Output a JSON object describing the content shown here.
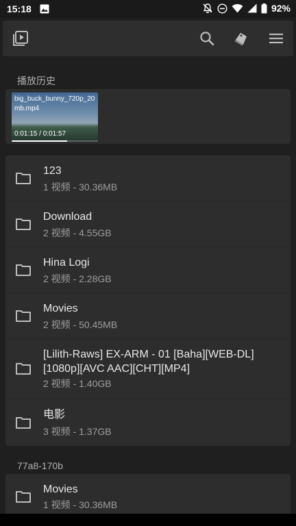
{
  "status_bar": {
    "time": "15:18",
    "battery_percent": "92%",
    "icons": [
      "image-icon",
      "bell-off-icon",
      "do-not-disturb-icon",
      "wifi-icon",
      "signal-icon",
      "battery-icon"
    ]
  },
  "toolbar": {
    "icons": [
      "video-library-icon",
      "search-icon",
      "tags-icon",
      "menu-icon"
    ]
  },
  "history": {
    "label": "播放历史",
    "item": {
      "title": "big_buck_bunny_720p_20mb.mp4",
      "time": "0:01:15 / 0:01:57",
      "progress": 0.64
    }
  },
  "folders": [
    {
      "name": "123",
      "meta": "1 视频 - 30.36MB"
    },
    {
      "name": "Download",
      "meta": "2 视频 - 4.55GB"
    },
    {
      "name": "Hina Logi",
      "meta": "2 视频 - 2.28GB"
    },
    {
      "name": "Movies",
      "meta": "2 视频 - 50.45MB"
    },
    {
      "name": "[Lilith-Raws] EX-ARM - 01 [Baha][WEB-DL][1080p][AVC AAC][CHT][MP4]",
      "meta": "2 视频 - 1.40GB"
    },
    {
      "name": "电影",
      "meta": "3 视频 - 1.37GB"
    }
  ],
  "storage2": {
    "label": "77a8-170b",
    "folders": [
      {
        "name": "Movies",
        "meta": "1 视频 - 30.36MB"
      }
    ]
  },
  "colors": {
    "background": "#1f1f1f",
    "card": "#2d2d2d",
    "toolbar": "#2e2e2e",
    "icon": "#bdbdbd"
  }
}
